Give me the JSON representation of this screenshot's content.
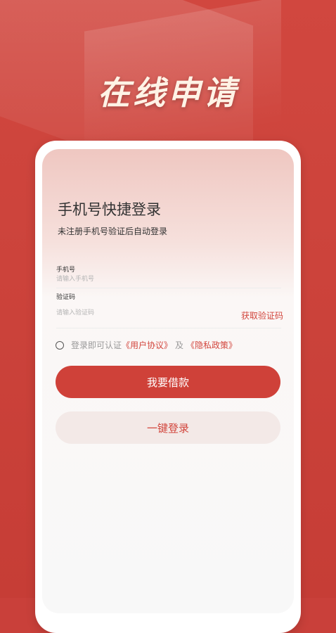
{
  "hero": {
    "title": "在线申请"
  },
  "login": {
    "title": "手机号快捷登录",
    "subtitle": "未注册手机号验证后自动登录"
  },
  "phone": {
    "label": "手机号",
    "placeholder": "请输入手机号"
  },
  "code": {
    "label": "验证码",
    "placeholder": "请输入验证码",
    "get_code": "获取验证码"
  },
  "agreement": {
    "prefix": "登录即可认证",
    "user_agreement": "《用户协议》",
    "conj": "及",
    "privacy_policy": "《隐私政策》"
  },
  "buttons": {
    "borrow": "我要借款",
    "one_click": "一键登录"
  },
  "colors": {
    "brand": "#cf4139",
    "background": "#c9403a",
    "link": "#d2463d"
  }
}
